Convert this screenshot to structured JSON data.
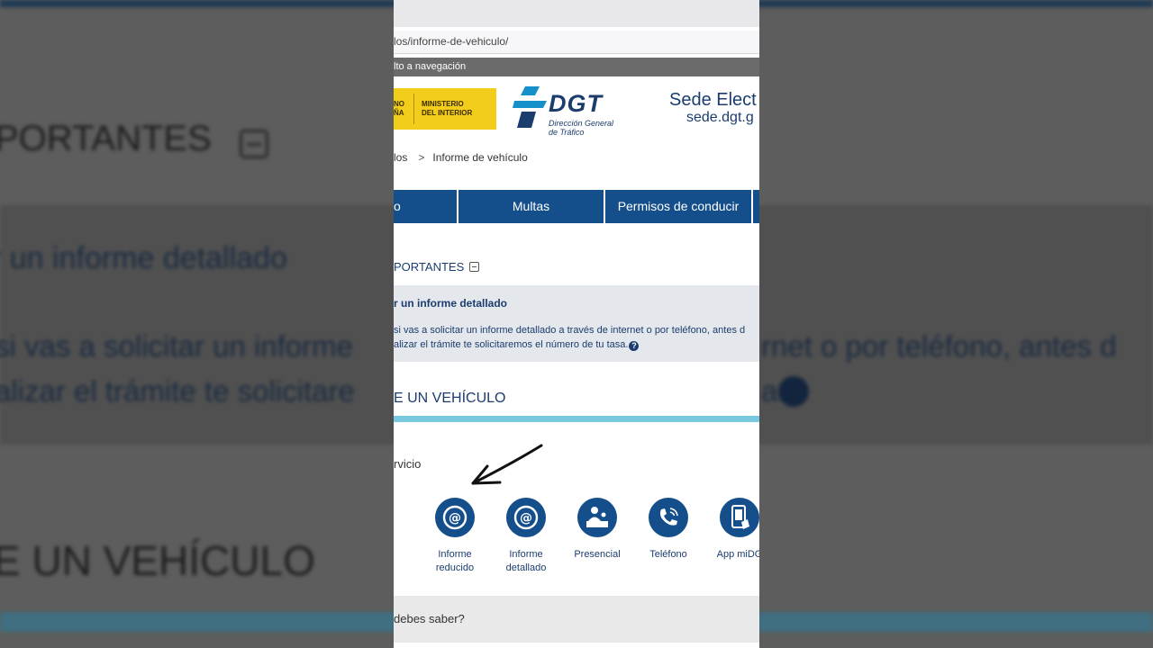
{
  "background": {
    "title_important": "PORTANTES",
    "subtitle": "r un informe detallado",
    "para_line1_left": "si vas a solicitar un informe",
    "para_line1_right": "rnet o por teléfono, antes d",
    "para_line2_left": "alizar el trámite te solicitare",
    "para_line2_right": "a.",
    "section_title": "E UN VEHÍCULO"
  },
  "browser": {
    "url": "los/informe-de-vehiculo/"
  },
  "header": {
    "skip_link": "lto a navegación",
    "gov_left": "NO\nÑA",
    "gov_right": "MINISTERIO\nDEL INTERIOR",
    "dgt_logo_text": "DGT",
    "dgt_logo_sub": "Dirección General\nde Tráfico",
    "sede_title": "Sede Elect",
    "sede_url": "sede.dgt.g"
  },
  "breadcrumb": {
    "prev": "los",
    "separator": ">",
    "current": "Informe de vehículo"
  },
  "nav": {
    "items": [
      {
        "label": "o"
      },
      {
        "label": "Multas"
      },
      {
        "label": "Permisos de conducir"
      }
    ]
  },
  "important": {
    "heading": "PORTANTES",
    "info_title": "r un informe detallado",
    "info_line1": "si vas a solicitar un informe detallado a través de internet o por teléfono, antes d",
    "info_line2": "alizar el trámite te solicitaremos el número de tu tasa."
  },
  "section": {
    "title": "E UN VEHÍCULO",
    "service_label": "rvicio"
  },
  "channels": [
    {
      "label": "Informe\nreducido",
      "icon": "at-icon"
    },
    {
      "label": "Informe\ndetallado",
      "icon": "at-icon"
    },
    {
      "label": "Presencial",
      "icon": "desk-person-icon"
    },
    {
      "label": "Teléfono",
      "icon": "phone-icon"
    },
    {
      "label": "App miDG",
      "icon": "mobile-app-icon"
    }
  ],
  "faq": {
    "title": "debes saber?"
  },
  "colors": {
    "brand_blue": "#144f8c",
    "text_blue": "#1b3d6e",
    "accent_cyan": "#78c9dd",
    "gov_yellow": "#f2cd1b"
  }
}
